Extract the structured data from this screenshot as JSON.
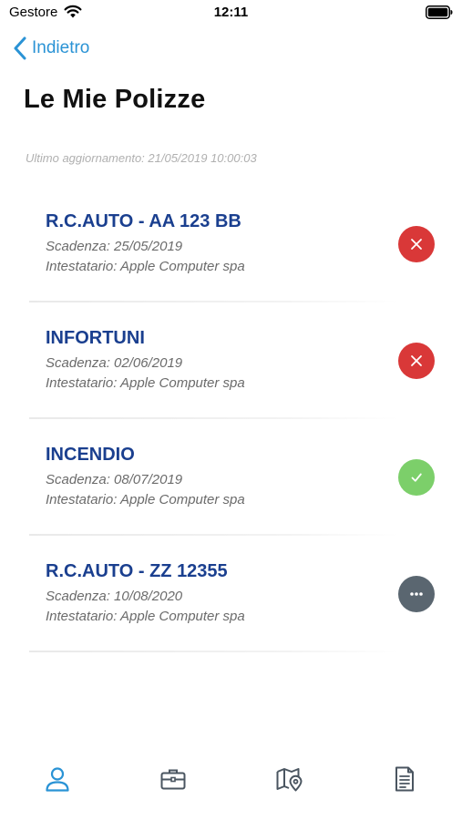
{
  "status_bar": {
    "carrier": "Gestore",
    "time": "12:11"
  },
  "nav": {
    "back_label": "Indietro"
  },
  "header": {
    "title": "Le Mie Polizze",
    "last_update": "Ultimo aggiornamento: 21/05/2019 10:00:03"
  },
  "policies": [
    {
      "name": "R.C.AUTO - AA 123 BB",
      "due": "Scadenza: 25/05/2019",
      "holder": "Intestatario:  Apple Computer spa",
      "status": "expired",
      "status_icon": "close-icon"
    },
    {
      "name": "INFORTUNI",
      "due": "Scadenza: 02/06/2019",
      "holder": "Intestatario:  Apple Computer spa",
      "status": "expired",
      "status_icon": "close-icon"
    },
    {
      "name": "INCENDIO",
      "due": "Scadenza: 08/07/2019",
      "holder": "Intestatario:  Apple Computer spa",
      "status": "active",
      "status_icon": "check-icon"
    },
    {
      "name": "R.C.AUTO - ZZ 12355",
      "due": "Scadenza: 10/08/2020",
      "holder": "Intestatario:  Apple Computer spa",
      "status": "pending",
      "status_icon": "more-icon"
    }
  ],
  "tab_bar": {
    "items": [
      {
        "icon": "user-icon",
        "active": true
      },
      {
        "icon": "briefcase-icon",
        "active": false
      },
      {
        "icon": "map-pin-icon",
        "active": false
      },
      {
        "icon": "document-icon",
        "active": false
      }
    ]
  },
  "colors": {
    "accent": "#2a93d5",
    "policy_title": "#1a3f8f",
    "expired": "#d93838",
    "active": "#7ccf6a",
    "pending": "#5a6670",
    "tab_inactive": "#4a5560"
  }
}
